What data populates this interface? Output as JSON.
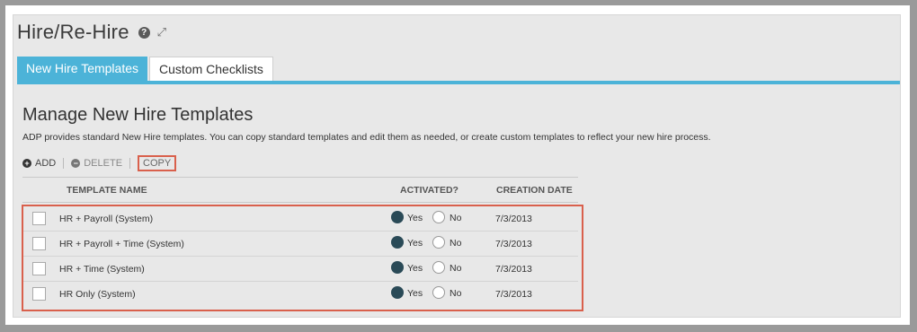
{
  "app": {
    "title": "Hire/Re-Hire",
    "help_icon": "question-circle-icon",
    "expand_icon": "expand-arrows-icon"
  },
  "tabs": [
    {
      "label": "New Hire Templates",
      "active": true
    },
    {
      "label": "Custom Checklists",
      "active": false
    }
  ],
  "section": {
    "title": "Manage New Hire Templates",
    "description": "ADP provides standard New Hire templates. You can copy standard templates and edit them as needed, or create custom templates to reflect your new hire process."
  },
  "toolbar": {
    "add_label": "ADD",
    "delete_label": "DELETE",
    "copy_label": "COPY"
  },
  "table": {
    "columns": [
      "TEMPLATE NAME",
      "ACTIVATED?",
      "CREATION DATE"
    ],
    "yes_label": "Yes",
    "no_label": "No",
    "rows": [
      {
        "name": "HR + Payroll (System)",
        "activated": "Yes",
        "date": "7/3/2013"
      },
      {
        "name": "HR + Payroll + Time (System)",
        "activated": "Yes",
        "date": "7/3/2013"
      },
      {
        "name": "HR + Time (System)",
        "activated": "Yes",
        "date": "7/3/2013"
      },
      {
        "name": "HR Only (System)",
        "activated": "Yes",
        "date": "7/3/2013"
      }
    ]
  },
  "colors": {
    "accent": "#4cb3d8",
    "highlight": "#d9604c",
    "radio_selected": "#2a4a57"
  }
}
